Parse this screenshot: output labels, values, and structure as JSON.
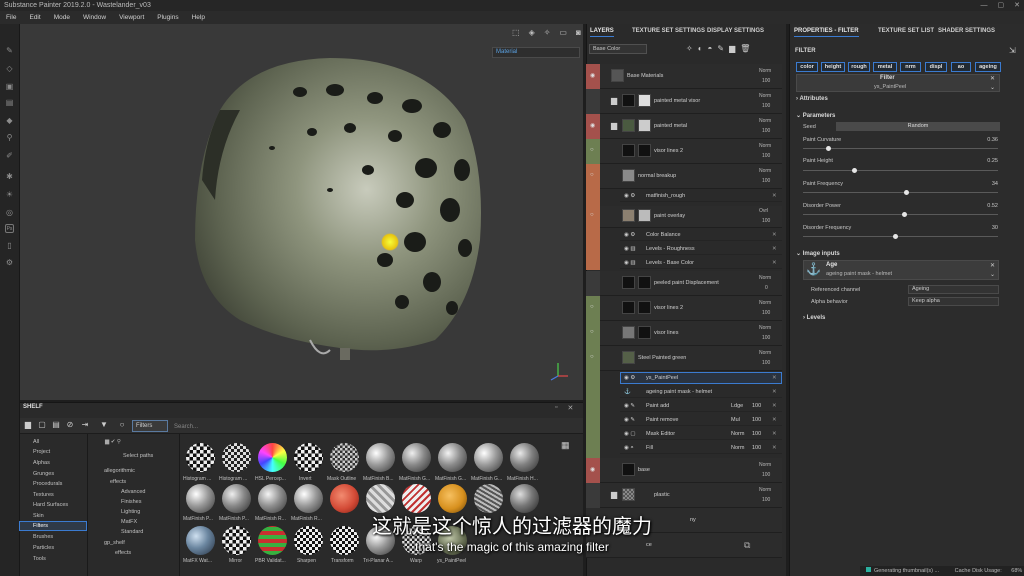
{
  "app": {
    "title": "Substance Painter 2019.2.0 - Wastelander_v03"
  },
  "menu": [
    "File",
    "Edit",
    "Mode",
    "Window",
    "Viewport",
    "Plugins",
    "Help"
  ],
  "viewport": {
    "material_select": "Material"
  },
  "shelf": {
    "title": "SHELF",
    "filters_label": "Filters",
    "search_placeholder": "Search...",
    "categories": [
      "All",
      "Project",
      "Alphas",
      "Grunges",
      "Procedurals",
      "Textures",
      "Hard Surfaces",
      "Skin",
      "Filters",
      "Brushes",
      "Particles",
      "Tools"
    ],
    "selected_category": "Filters",
    "paths": {
      "header": "Select paths",
      "items": [
        "allegorithmic",
        "effects",
        "Advanced",
        "Finishes",
        "Lighting",
        "MatFX",
        "Standard",
        "gp_shelf",
        "effects"
      ]
    },
    "thumbs_row1": [
      "Histogram ...",
      "Histogram ...",
      "HSL Percep...",
      "Invert",
      "Mask Outline",
      "MatFinish B...",
      "MatFinish G...",
      "MatFinish G...",
      "MatFinish G...",
      "MatFinish H..."
    ],
    "thumbs_row2": [
      "MatFinish P...",
      "MatFinish P...",
      "MatFinish R...",
      "MatFinish R...",
      "",
      "",
      "",
      "",
      "",
      ""
    ],
    "thumbs_row3": [
      "MatFX Wat...",
      "Mirror",
      "PBR Validat...",
      "Sharpen",
      "Transform",
      "Tri-Planar A...",
      "Warp",
      "ys_PaintPeel"
    ]
  },
  "layers_panel": {
    "tabs": [
      "LAYERS",
      "TEXTURE SET SETTINGS",
      "DISPLAY SETTINGS"
    ],
    "channel": "Base Color",
    "layers": [
      {
        "name": "Base Materials",
        "blend": "Norm",
        "opacity": "100"
      },
      {
        "name": "painted metal visor",
        "blend": "Norm",
        "opacity": "100"
      },
      {
        "name": "painted metal",
        "blend": "Norm",
        "opacity": "100"
      },
      {
        "name": "visor lines 2",
        "blend": "Norm",
        "opacity": "100"
      },
      {
        "name": "normal breakup",
        "blend": "Norm",
        "opacity": "100"
      },
      {
        "name": "matfinish_rough",
        "blend": "",
        "opacity": ""
      },
      {
        "name": "paint overlay",
        "blend": "Ovrl",
        "opacity": "100"
      },
      {
        "name": "Color Balance",
        "blend": "",
        "opacity": ""
      },
      {
        "name": "Levels - Roughness",
        "blend": "",
        "opacity": ""
      },
      {
        "name": "Levels - Base Color",
        "blend": "",
        "opacity": ""
      },
      {
        "name": "peeled paint Displacement",
        "blend": "Norm",
        "opacity": "0"
      },
      {
        "name": "visor lines 2",
        "blend": "Norm",
        "opacity": "100"
      },
      {
        "name": "visor lines",
        "blend": "Norm",
        "opacity": "100"
      },
      {
        "name": "Steel Painted green",
        "blend": "Norm",
        "opacity": "100"
      },
      {
        "name": "ys_PaintPeel",
        "blend": "",
        "opacity": ""
      },
      {
        "name": "ageing paint mask - helmet",
        "blend": "",
        "opacity": ""
      },
      {
        "name": "Paint add",
        "blend": "Ldge",
        "opacity": "100"
      },
      {
        "name": "Paint remove",
        "blend": "Mul",
        "opacity": "100"
      },
      {
        "name": "Mask Editor",
        "blend": "Norm",
        "opacity": "100"
      },
      {
        "name": "Fill",
        "blend": "Norm",
        "opacity": "100"
      },
      {
        "name": "base",
        "blend": "Norm",
        "opacity": "100"
      },
      {
        "name": "plastic",
        "blend": "Norm",
        "opacity": "100"
      },
      {
        "name": "ny",
        "blend": "",
        "opacity": ""
      },
      {
        "name": "ce",
        "blend": "",
        "opacity": ""
      }
    ]
  },
  "props_panel": {
    "tabs": [
      "PROPERTIES - FILTER",
      "TEXTURE SET LIST",
      "SHADER SETTINGS"
    ],
    "section_filter": "FILTER",
    "chips": [
      "color",
      "height",
      "rough",
      "metal",
      "nrm",
      "displ",
      "ao",
      "ageing"
    ],
    "filter_label": "Filter",
    "filter_name": "ys_PaintPeel",
    "attributes": "Attributes",
    "parameters": "Parameters",
    "seed_label": "Seed",
    "seed_value": "Random",
    "params": [
      {
        "label": "Paint Curvature",
        "value": "0.36",
        "fraction": 0.13
      },
      {
        "label": "Paint Height",
        "value": "0.25",
        "fraction": 0.26
      },
      {
        "label": "Paint Frequency",
        "value": "34",
        "fraction": 0.53
      },
      {
        "label": "Disorder Power",
        "value": "0.52",
        "fraction": 0.52
      },
      {
        "label": "Disorder Frequency",
        "value": "30",
        "fraction": 0.47
      }
    ],
    "image_inputs": "Image inputs",
    "input_title": "Age",
    "input_sub": "ageing paint mask - helmet",
    "ref_channel_label": "Referenced channel",
    "ref_channel_value": "Ageing",
    "alpha_label": "Alpha behavior",
    "alpha_value": "Keep alpha",
    "levels": "Levels"
  },
  "status": {
    "text": "Generating thumbnail(s) ...",
    "cache": "Cache Disk Usage:",
    "cache_pct": "68%"
  },
  "subtitles": {
    "cn": "这就是这个惊人的过滤器的魔力",
    "en": "that's the magic of this amazing filter"
  },
  "colors": {
    "accent": "#3b7bd0",
    "strip_red": "#a4514c",
    "strip_green": "#6d7f52",
    "strip_orange": "#b86a48"
  }
}
